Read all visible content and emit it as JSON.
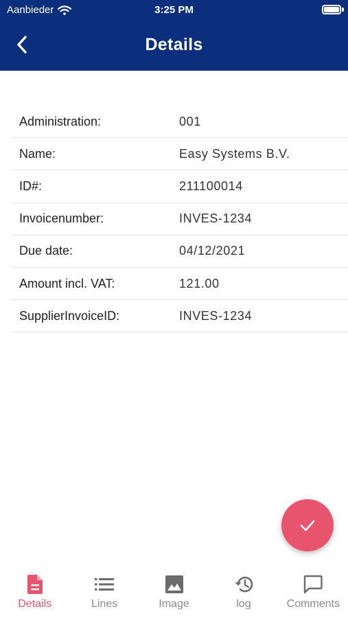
{
  "status_bar": {
    "carrier": "Aanbieder",
    "time": "3:25 PM"
  },
  "header": {
    "title": "Details",
    "back_icon": "chevron-left-icon"
  },
  "details": [
    {
      "label": "Administration:",
      "value": "001"
    },
    {
      "label": "Name:",
      "value": "Easy Systems B.V."
    },
    {
      "label": "ID#:",
      "value": "211100014"
    },
    {
      "label": "Invoicenumber:",
      "value": "INVES-1234"
    },
    {
      "label": "Due date:",
      "value": "04/12/2021"
    },
    {
      "label": "Amount incl. VAT:",
      "value": "121.00"
    },
    {
      "label": "SupplierInvoiceID:",
      "value": "INVES-1234"
    }
  ],
  "fab": {
    "icon": "checkmark-icon"
  },
  "tabs": [
    {
      "label": "Details",
      "icon": "document-icon",
      "active": true
    },
    {
      "label": "Lines",
      "icon": "list-icon",
      "active": false
    },
    {
      "label": "Image",
      "icon": "image-icon",
      "active": false
    },
    {
      "label": "log",
      "icon": "history-icon",
      "active": false
    },
    {
      "label": "Comments",
      "icon": "comment-icon",
      "active": false
    }
  ],
  "colors": {
    "header_bg": "#0b2f7c",
    "accent": "#e8546d",
    "inactive": "#8a8a8a"
  }
}
